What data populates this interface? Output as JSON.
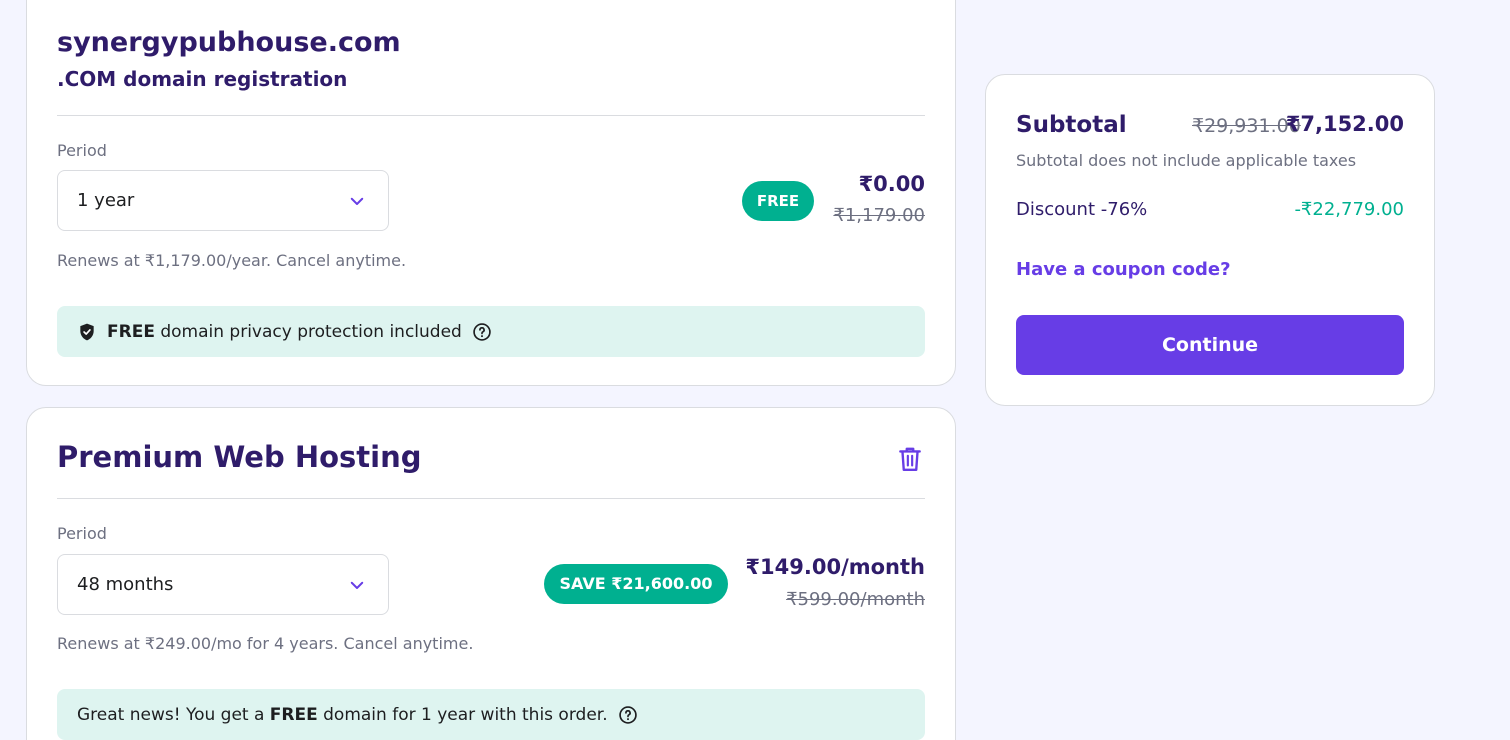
{
  "domain": {
    "name": "synergypubhouse.com",
    "subtitle": ".COM domain registration",
    "period_label": "Period",
    "period_value": "1 year",
    "badge": "FREE",
    "price": "₹0.00",
    "old_price": "₹1,179.00",
    "renew_text": "Renews at ₹1,179.00/year. Cancel anytime.",
    "privacy_bold": "FREE",
    "privacy_text": " domain privacy protection included"
  },
  "hosting": {
    "title": "Premium Web Hosting",
    "period_label": "Period",
    "period_value": "48 months",
    "badge": "SAVE ₹21,600.00",
    "price": "₹149.00/month",
    "old_price": "₹599.00/month",
    "renew_text": "Renews at ₹249.00/mo for 4 years. Cancel anytime.",
    "news_prefix": "Great news! You get a ",
    "news_bold": "FREE",
    "news_suffix": " domain for 1 year with this order."
  },
  "summary": {
    "title": "Subtotal",
    "old_total": "₹29,931.00",
    "total": "₹7,152.00",
    "note": "Subtotal does not include applicable taxes",
    "discount_label": "Discount -76%",
    "discount_value": "-₹22,779.00",
    "coupon": "Have a coupon code?",
    "continue": "Continue"
  },
  "colors": {
    "accent": "#673de6",
    "success": "#00b090",
    "heading": "#2f1c6a",
    "info_bg": "#def4f0",
    "page_bg": "#f4f5ff"
  },
  "icons": {
    "dropdown": "chevron-down-icon",
    "shield": "shield-check-icon",
    "help": "question-circle-icon",
    "delete": "trash-icon"
  }
}
